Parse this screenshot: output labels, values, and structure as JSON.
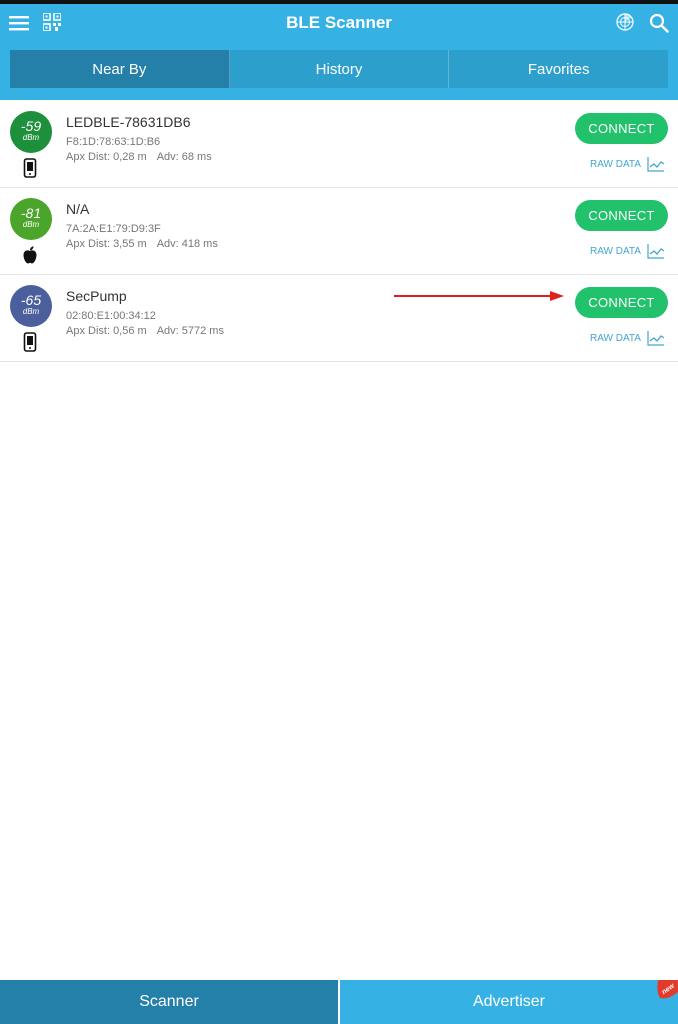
{
  "app": {
    "title": "BLE Scanner"
  },
  "tabs": [
    {
      "label": "Near By"
    },
    {
      "label": "History"
    },
    {
      "label": "Favorites"
    }
  ],
  "devices": [
    {
      "name": "LEDBLE-78631DB6",
      "mac": "F8:1D:78:63:1D:B6",
      "rssi": "-59",
      "unit": "dBm",
      "dist": "Apx Dist: 0,28 m",
      "adv": "Adv: 68 ms",
      "color": "#1e8f3b",
      "device_icon": "phone-icon"
    },
    {
      "name": "N/A",
      "mac": "7A:2A:E1:79:D9:3F",
      "rssi": "-81",
      "unit": "dBm",
      "dist": "Apx Dist: 3,55 m",
      "adv": "Adv: 418 ms",
      "color": "#4aa52a",
      "device_icon": "apple-icon"
    },
    {
      "name": "SecPump",
      "mac": "02:80:E1:00:34:12",
      "rssi": "-65",
      "unit": "dBm",
      "dist": "Apx Dist: 0,56 m",
      "adv": "Adv: 5772 ms",
      "color": "#4b5f9c",
      "device_icon": "phone-icon"
    }
  ],
  "actions": {
    "connect_label": "CONNECT",
    "raw_label": "RAW DATA"
  },
  "bottom_tabs": [
    {
      "label": "Scanner"
    },
    {
      "label": "Advertiser"
    }
  ],
  "badge": {
    "label": "new"
  },
  "colors": {
    "primary": "#36b1e3",
    "primary_dark": "#2480a8",
    "connect": "#22c16b",
    "arrow": "#e11d1d"
  }
}
